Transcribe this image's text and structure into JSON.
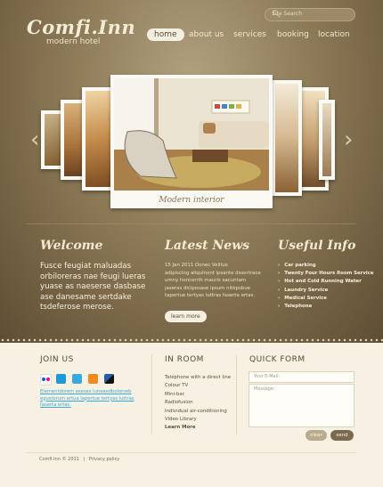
{
  "header": {
    "logo_name": "Comfi.Inn",
    "logo_sub": "modern hotel",
    "search_placeholder": "Site Search"
  },
  "nav": [
    {
      "label": "home",
      "active": true
    },
    {
      "label": "about us",
      "active": false
    },
    {
      "label": "services",
      "active": false
    },
    {
      "label": "booking",
      "active": false
    },
    {
      "label": "location",
      "active": false
    }
  ],
  "slider": {
    "caption": "Modern interior",
    "prev_icon": "chevron-left-icon",
    "next_icon": "chevron-right-icon"
  },
  "welcome": {
    "title": "Welcome",
    "text": "Fusce feugiat maluadas orbiloreras nae feugi lueras yuase as naeserse dasbase ase danesame sertdake tsdeferose merose."
  },
  "news": {
    "title": "Latest News",
    "date": "15 Jan 2011 Donec Velitus",
    "body": "adipiscing aliquinont ipsante dssertrace umny honcerrih mauris sacuntam jaseras diciposase ipsum nitbpsbue tapertue tertyas luttras faserta ertas.",
    "button": "learn more"
  },
  "info": {
    "title": "Useful Info",
    "items": [
      "Car parking",
      "Twenty Four Hours Room Service",
      "Hot and Cold Running Water",
      "Laundry Service",
      "Medical Service",
      "Telephone"
    ]
  },
  "join": {
    "title": "JOIN US",
    "text": "Elementdorem eseses luneaedbolorseb egustorum ertua lapertue tertyas luttras faserta ertas."
  },
  "room": {
    "title": "IN ROOM",
    "items": [
      "Telephone with a direct line",
      "Colour TV",
      "Mini-bar",
      "Radiofusion",
      "Individual air-conditioning",
      "Video Library",
      "Learn More"
    ]
  },
  "form": {
    "title": "QUICK FORM",
    "email_placeholder": "Your E-Mail:",
    "message_placeholder": "Message:",
    "clear": "clear",
    "send": "send"
  },
  "footer": {
    "copyright": "Comfi.Inn © 2011",
    "sep": "|",
    "privacy": "Privacy policy"
  },
  "colors": {
    "accent_light": "#f4efe0",
    "brown": "#5b4a32",
    "link_blue": "#3aa9d8"
  }
}
